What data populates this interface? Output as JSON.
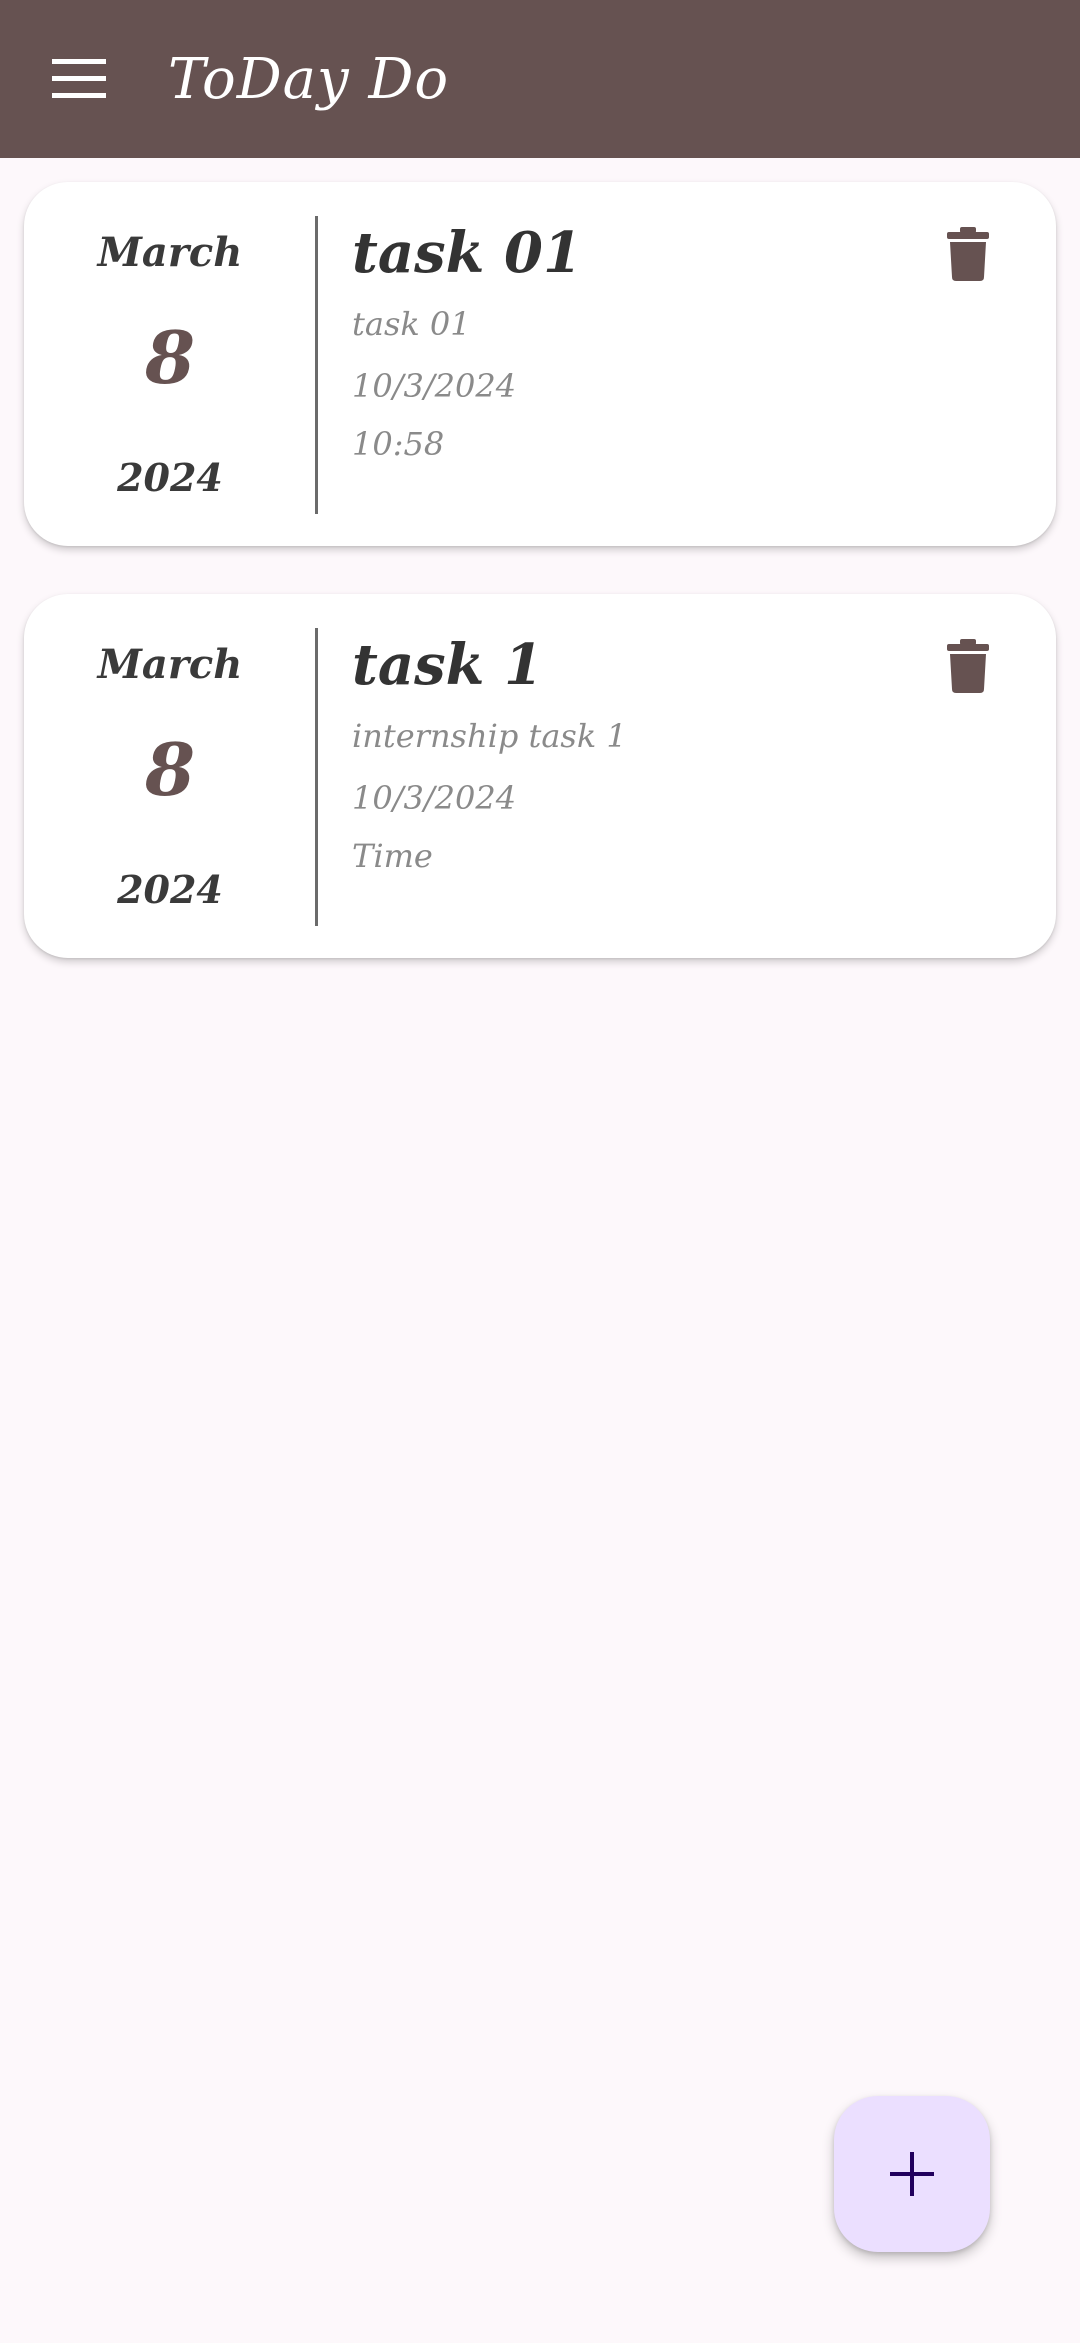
{
  "app": {
    "title": "ToDay Do",
    "colors": {
      "appbar": "#665251",
      "accent": "#665251",
      "background": "#fdf8fb",
      "fab": "#ebdfff",
      "fab_icon": "#21005d"
    }
  },
  "header": {
    "menu_icon": "hamburger-menu-icon"
  },
  "tasks": [
    {
      "month": "March",
      "day": "8",
      "year": "2024",
      "title": "task 01",
      "description": "task 01",
      "date": "10/3/2024",
      "time": "10:58",
      "delete_icon": "trash-icon"
    },
    {
      "month": "March",
      "day": "8",
      "year": "2024",
      "title": "task 1",
      "description": "internship task 1",
      "date": "10/3/2024",
      "time": "Time",
      "delete_icon": "trash-icon"
    }
  ],
  "fab": {
    "icon": "plus-icon"
  }
}
